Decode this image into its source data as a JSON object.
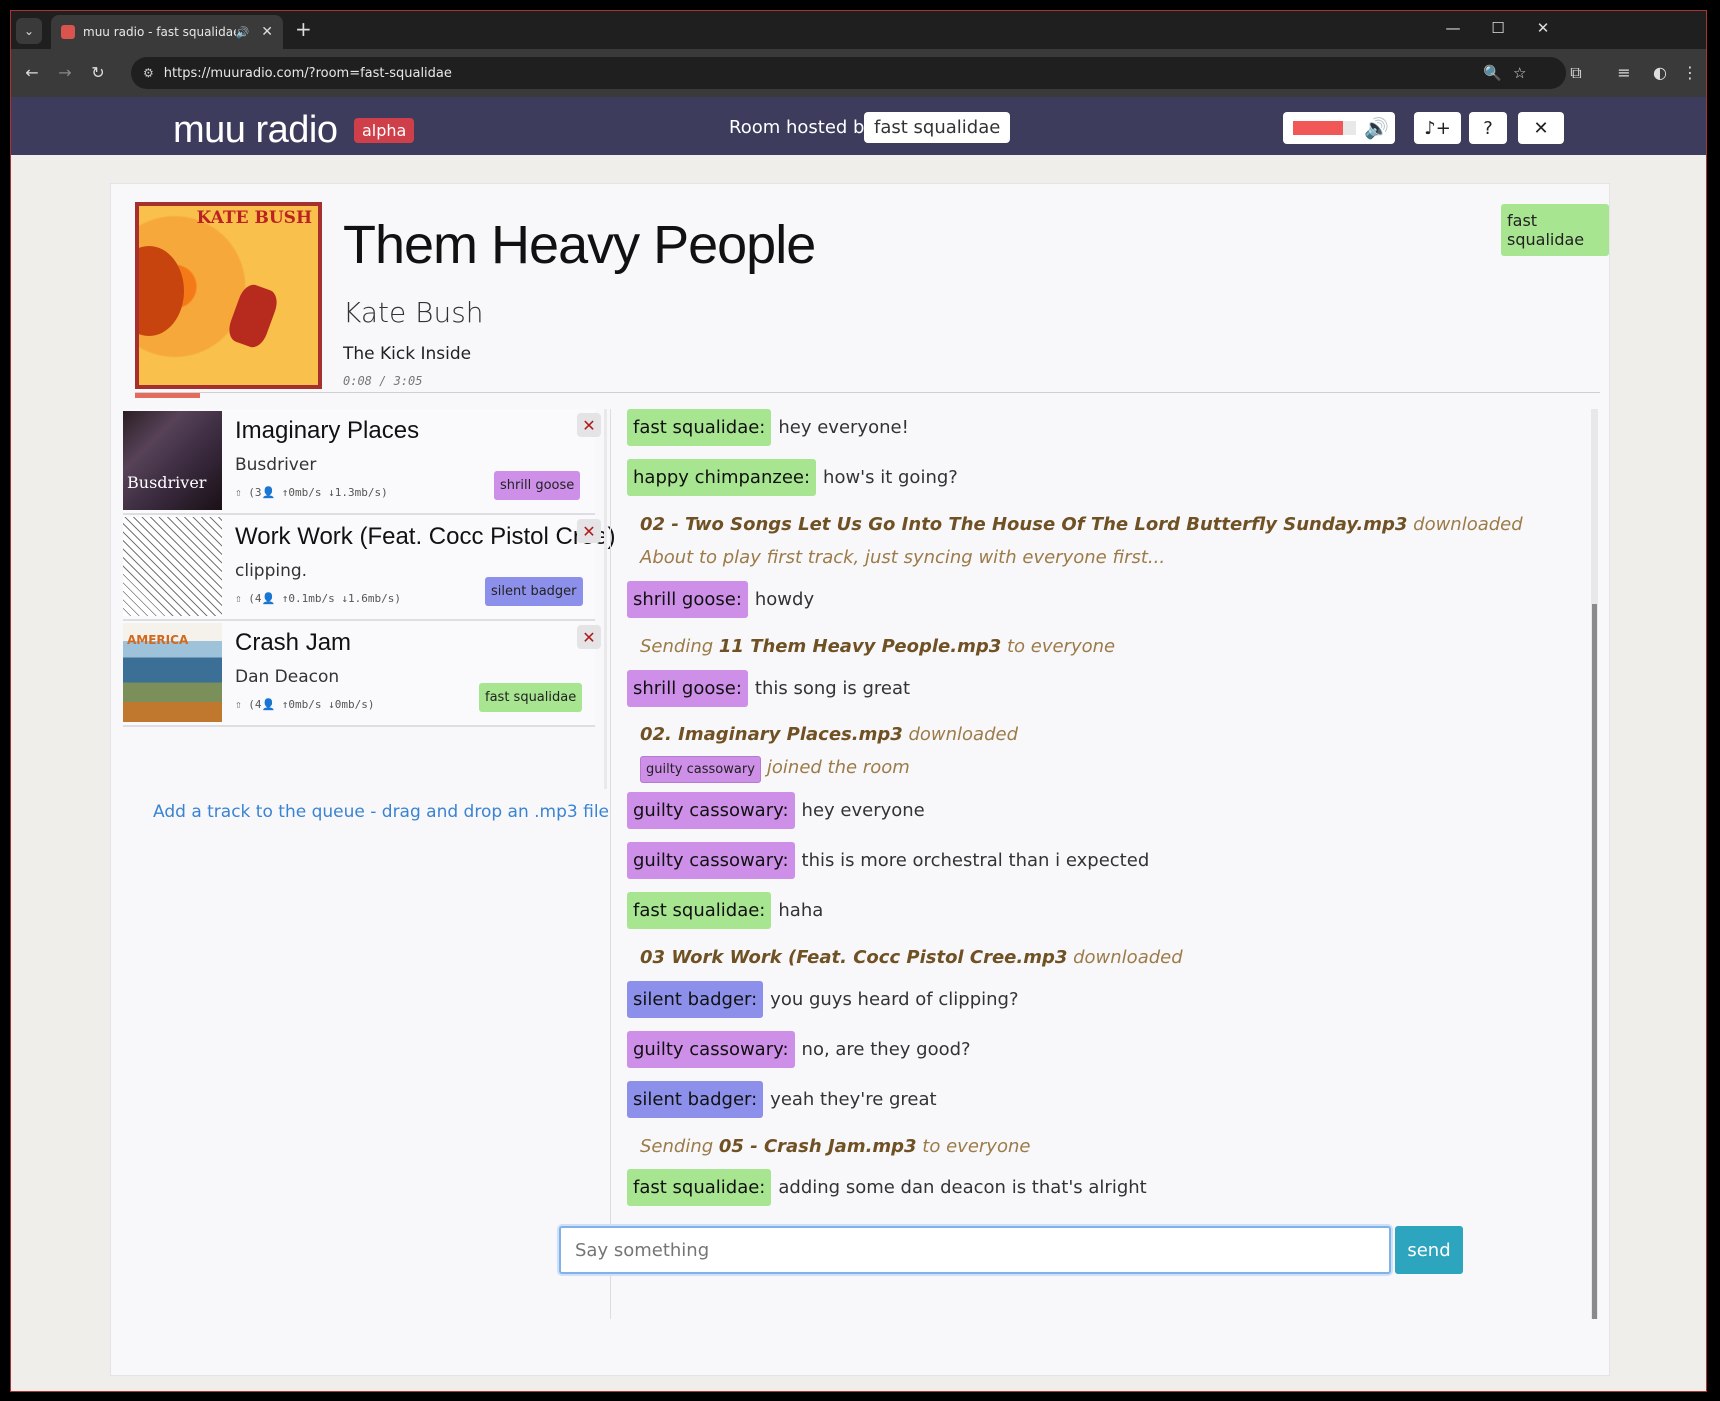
{
  "browser": {
    "tab_title": "muu radio - fast squalidae",
    "url": "https://muuradio.com/?room=fast-squalidae"
  },
  "header": {
    "brand": "muu radio",
    "badge": "alpha",
    "hosted_label": "Room hosted by",
    "host_name": "fast squalidae",
    "volume_level": 0.8,
    "accent": "#3d3c5d"
  },
  "now_playing": {
    "title": "Them Heavy People",
    "artist": "Kate Bush",
    "album": "The Kick Inside",
    "time": "0:08 / 3:05",
    "art_text": "KATE BUSH",
    "owner": "fast squalidae"
  },
  "queue": [
    {
      "title": "Imaginary Places",
      "artist": "Busdriver",
      "stats": "⇧ (3👤 ↑0mb/s ↓1.3mb/s)",
      "owner": "shrill goose",
      "owner_color": "#cd8fe8",
      "art_text": "Busdriver"
    },
    {
      "title": "Work Work (Feat. Cocc Pistol Cree)",
      "artist": "clipping.",
      "stats": "⇧ (4👤 ↑0.1mb/s ↓1.6mb/s)",
      "owner": "silent badger",
      "owner_color": "#8d90ea",
      "art_text": ""
    },
    {
      "title": "Crash Jam",
      "artist": "Dan Deacon",
      "stats": "⇧ (4👤 ↑0mb/s ↓0mb/s)",
      "owner": "fast squalidae",
      "owner_color": "#a8e591",
      "art_text": "AMERICA"
    }
  ],
  "add_track_hint": "Add a track to the queue - drag and drop an .mp3 file",
  "chat": {
    "messages": [
      {
        "nick": "fast squalidae:",
        "text": "hey everyone!"
      },
      {
        "nick": "happy chimpanzee:",
        "text": "how's it going?"
      },
      {
        "sys_bold": "02 - Two Songs Let Us Go Into The House Of The Lord Butterfly Sunday.mp3",
        "sys_text": " downloaded"
      },
      {
        "sys_text": "About to play first track, just syncing with everyone first..."
      },
      {
        "nick": "shrill goose:",
        "text": "howdy"
      },
      {
        "sys_pre": "Sending ",
        "sys_bold": "11 Them Heavy People.mp3",
        "sys_text": " to everyone"
      },
      {
        "nick": "shrill goose:",
        "text": "this song is great"
      },
      {
        "sys_bold": "02. Imaginary Places.mp3",
        "sys_text": " downloaded"
      },
      {
        "join_badge": "guilty cassowary",
        "sys_text": "joined the room"
      },
      {
        "nick": "guilty cassowary:",
        "text": "hey everyone"
      },
      {
        "nick": "guilty cassowary:",
        "text": "this is more orchestral than i expected"
      },
      {
        "nick": "fast squalidae:",
        "text": "haha"
      },
      {
        "sys_bold": "03 Work Work (Feat. Cocc Pistol Cree.mp3",
        "sys_text": " downloaded"
      },
      {
        "nick": "silent badger:",
        "text": "you guys heard of clipping?"
      },
      {
        "nick": "guilty cassowary:",
        "text": "no, are they good?"
      },
      {
        "nick": "silent badger:",
        "text": "yeah they're great"
      },
      {
        "sys_pre": "Sending ",
        "sys_bold": "05 - Crash Jam.mp3",
        "sys_text": " to everyone"
      },
      {
        "nick": "fast squalidae:",
        "text": "adding some dan deacon is that's alright"
      }
    ],
    "input_placeholder": "Say something",
    "send_label": "send"
  },
  "colors": {
    "green": "#a8e591",
    "purple": "#cd8fe8",
    "blue": "#8d90ea",
    "send": "#2ea5bf",
    "alpha": "#cf3f4a"
  }
}
